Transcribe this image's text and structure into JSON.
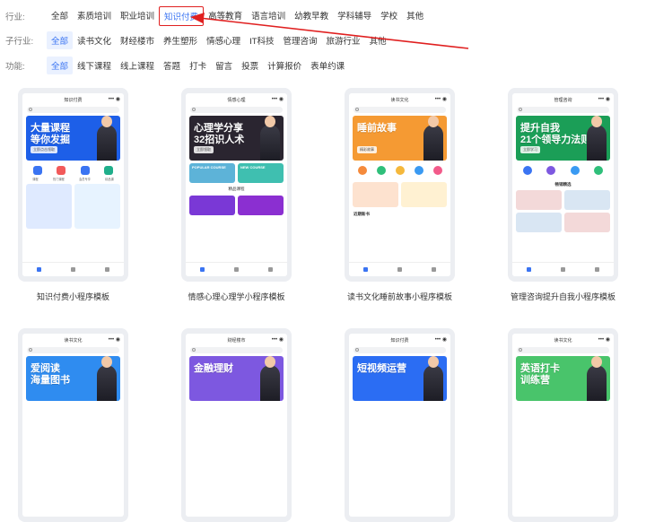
{
  "filters": {
    "industry": {
      "label": "行业:",
      "options": [
        "全部",
        "素质培训",
        "职业培训",
        "知识付费",
        "高等教育",
        "语言培训",
        "幼教早教",
        "学科辅导",
        "学校",
        "其他"
      ]
    },
    "subindustry": {
      "label": "子行业:",
      "options": [
        "全部",
        "读书文化",
        "财经楼市",
        "养生塑形",
        "情感心理",
        "IT科技",
        "管理咨询",
        "旅游行业",
        "其他"
      ]
    },
    "feature": {
      "label": "功能:",
      "options": [
        "全部",
        "线下课程",
        "线上课程",
        "答题",
        "打卡",
        "留言",
        "投票",
        "计算报价",
        "表单约课"
      ]
    }
  },
  "templates": [
    {
      "caption": "知识付费小程序模板",
      "screen_title": "知识付费",
      "banner_line1": "大量课程",
      "banner_line2": "等你发掘",
      "banner_sub": "立即点击领取",
      "banner_color": "#1d5fe8",
      "icon_labels": [
        "课程",
        "热门课程",
        "会员专享",
        "精品课"
      ]
    },
    {
      "caption": "情感心理心理学小程序模板",
      "screen_title": "情感心理",
      "banner_line1": "心理学分享",
      "banner_line2": "32招识人术",
      "banner_sub": "立即领取",
      "banner_color": "#2a2530",
      "tile_a": "POPULAR COURSE",
      "tile_b": "NEW COURSE",
      "section_title": "精品课程"
    },
    {
      "caption": "读书文化睡前故事小程序模板",
      "screen_title": "读书文化",
      "banner_line1": "睡前故事",
      "banner_line2": "",
      "banner_sub": "精彩故事",
      "banner_color": "#f59a33",
      "section_title": "近期新书"
    },
    {
      "caption": "管理咨询提升自我小程序模板",
      "screen_title": "管理咨询",
      "banner_line1": "提升自我",
      "banner_line2": "21个领导力法则",
      "banner_sub": "立即学习",
      "banner_color": "#1b9e57",
      "section_title": "畅销精选"
    },
    {
      "caption": "",
      "screen_title": "读书文化",
      "banner_line1": "爱阅读",
      "banner_line2": "海量图书",
      "banner_sub": "",
      "banner_color": "#2f8cf0"
    },
    {
      "caption": "",
      "screen_title": "财经楼市",
      "banner_line1": "金融理财",
      "banner_line2": "",
      "banner_sub": "",
      "banner_color": "#7d58e0"
    },
    {
      "caption": "",
      "screen_title": "知识付费",
      "banner_line1": "短视频运营",
      "banner_line2": "",
      "banner_sub": "",
      "banner_color": "#2b6df3"
    },
    {
      "caption": "",
      "screen_title": "读书文化",
      "banner_line1": "英语打卡",
      "banner_line2": "训练营",
      "banner_sub": "",
      "banner_color": "#49c46b"
    }
  ],
  "colors": {
    "accent": "#3a74f2",
    "highlight_box": "#e02020"
  }
}
